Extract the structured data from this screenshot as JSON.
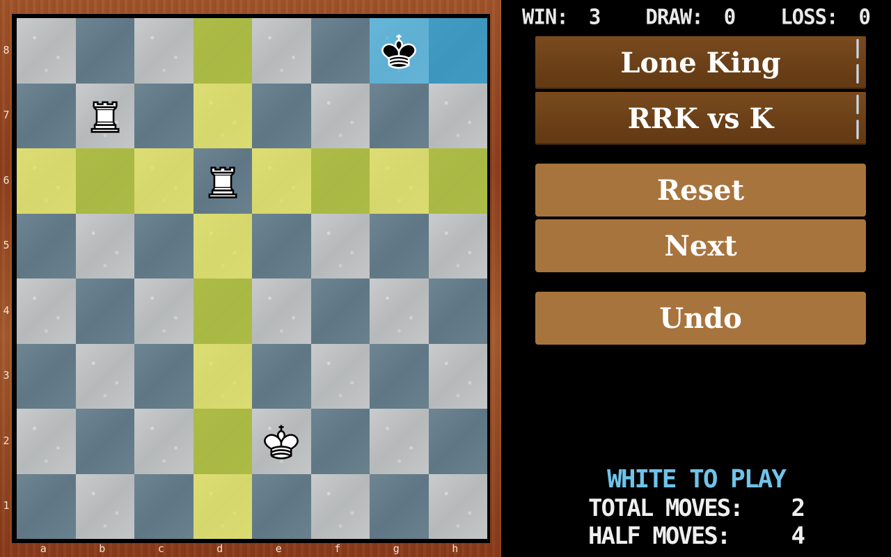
{
  "scoreboard": {
    "win_label": "WIN:",
    "win": "3",
    "draw_label": "DRAW:",
    "draw": "0",
    "loss_label": "LOSS:",
    "loss": "0"
  },
  "modes": [
    {
      "label": "Lone King"
    },
    {
      "label": "RRK vs K"
    }
  ],
  "actions": {
    "reset": "Reset",
    "next": "Next",
    "undo": "Undo"
  },
  "status": {
    "turn": "WHITE TO PLAY",
    "total_moves_label": "TOTAL MOVES:",
    "total_moves": "2",
    "half_moves_label": "HALF MOVES:",
    "half_moves": "4"
  },
  "colors": {
    "turn_text": "#6fc3ea",
    "highlight_move": "#e8e83c",
    "highlight_selected": "#28aae1",
    "button": "#a8743d",
    "mode_button": "#6a3f17"
  },
  "board": {
    "files": [
      "a",
      "b",
      "c",
      "d",
      "e",
      "f",
      "g",
      "h"
    ],
    "ranks": [
      "8",
      "7",
      "6",
      "5",
      "4",
      "3",
      "2",
      "1"
    ],
    "pieces": [
      {
        "square": "g8",
        "type": "king",
        "color": "black"
      },
      {
        "square": "b7",
        "type": "rook",
        "color": "white"
      },
      {
        "square": "d6",
        "type": "rook",
        "color": "white"
      },
      {
        "square": "e2",
        "type": "king",
        "color": "white"
      }
    ],
    "highlight_yellow": [
      "d8",
      "d7",
      "d5",
      "d4",
      "d3",
      "d2",
      "d1",
      "a6",
      "b6",
      "c6",
      "e6",
      "f6",
      "g6",
      "h6"
    ],
    "highlight_blue": [
      "g8",
      "h8"
    ]
  }
}
